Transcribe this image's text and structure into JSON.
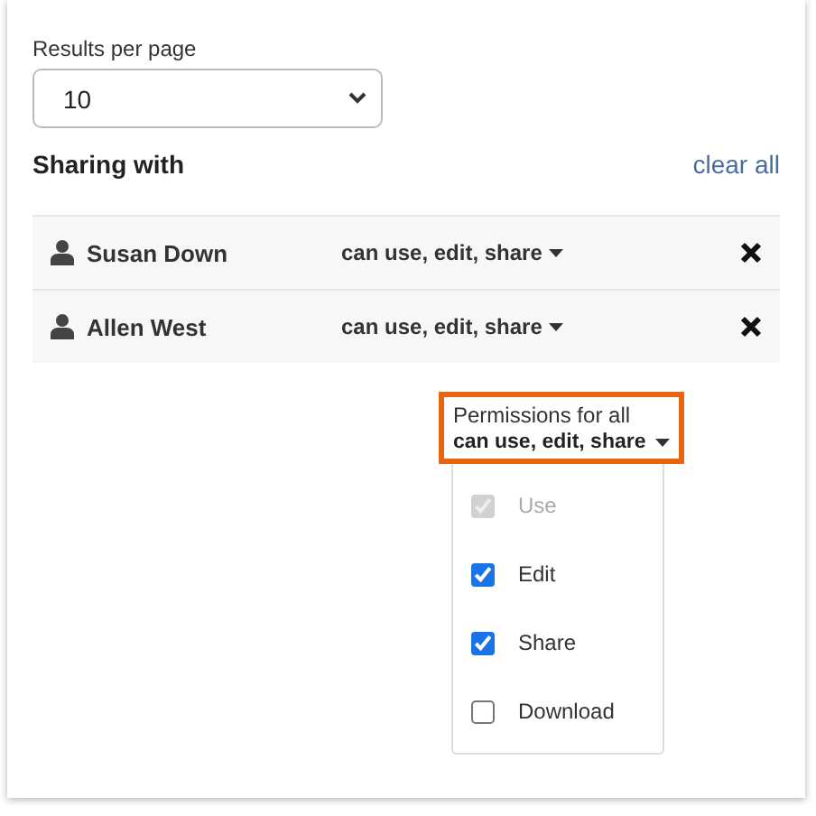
{
  "results_per_page": {
    "label": "Results per page",
    "value": "10"
  },
  "sharing": {
    "title": "Sharing with",
    "clear_link": "clear all",
    "rows": [
      {
        "name": "Susan Down",
        "permission": "can use, edit, share"
      },
      {
        "name": "Allen West",
        "permission": "can use, edit, share"
      }
    ]
  },
  "permissions_for_all": {
    "label": "Permissions for all",
    "value": "can use, edit, share",
    "highlighted": true,
    "options": [
      {
        "label": "Use",
        "checked": true,
        "disabled": true
      },
      {
        "label": "Edit",
        "checked": true,
        "disabled": false
      },
      {
        "label": "Share",
        "checked": true,
        "disabled": false
      },
      {
        "label": "Download",
        "checked": false,
        "disabled": false
      }
    ]
  }
}
